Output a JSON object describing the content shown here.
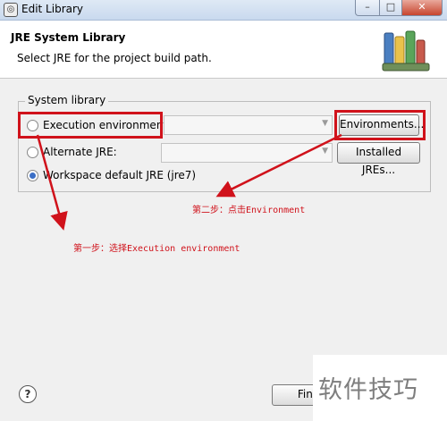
{
  "window": {
    "title": "Edit Library",
    "minimize_glyph": "–",
    "maximize_glyph": "□",
    "close_glyph": "✕"
  },
  "header": {
    "title": "JRE System Library",
    "subtitle": "Select JRE for the project build path.",
    "icon": "books-icon"
  },
  "system_library": {
    "group_label": "System library",
    "options": [
      {
        "label": "Execution environment:",
        "selected": false
      },
      {
        "label": "Alternate JRE:",
        "selected": false
      },
      {
        "label": "Workspace default JRE (jre7)",
        "selected": true
      }
    ],
    "environments_button": "Environments...",
    "installed_jres_button": "Installed JREs..."
  },
  "annotations": {
    "step2": "第二步：点击Environment",
    "step1": "第一步：选择Execution environment",
    "color": "#d0121b"
  },
  "footer": {
    "help_glyph": "?",
    "finish_button": "Finish"
  },
  "watermark": "软件技巧"
}
